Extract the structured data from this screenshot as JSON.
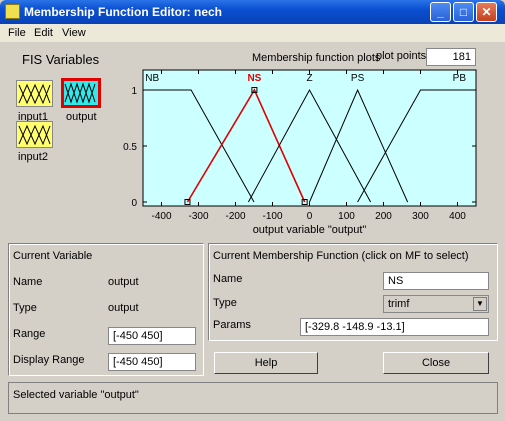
{
  "window": {
    "title": "Membership Function Editor: nech"
  },
  "menu": [
    "File",
    "Edit",
    "View"
  ],
  "fis_variables": {
    "title": "FIS Variables",
    "items": [
      {
        "label": "input1",
        "selected": false
      },
      {
        "label": "output",
        "selected": true
      },
      {
        "label": "input2",
        "selected": false
      }
    ]
  },
  "plot": {
    "header": "Membership function plots",
    "plot_points_label": "plot points:",
    "plot_points_value": "181",
    "xlabel": "output variable \"output\"",
    "xlim": [
      -450,
      450
    ],
    "ylim": [
      0,
      1
    ],
    "xticks": [
      -400,
      -300,
      -200,
      -100,
      0,
      100,
      200,
      300,
      400
    ],
    "yticks": [
      0,
      0.5,
      1
    ],
    "background": "#ccffff",
    "line_color": "#000000",
    "selected_color": "#e00000"
  },
  "chart_data": {
    "type": "line",
    "title": "",
    "xlabel": "output variable \"output\"",
    "ylabel": "",
    "xlim": [
      -450,
      450
    ],
    "ylim": [
      0,
      1
    ],
    "series": [
      {
        "name": "NB",
        "mf_type": "trapmf",
        "points": [
          [
            -450,
            1
          ],
          [
            -320,
            1
          ],
          [
            -150,
            0
          ]
        ],
        "selected": false
      },
      {
        "name": "NS",
        "mf_type": "trimf",
        "points": [
          [
            -329.8,
            0
          ],
          [
            -148.9,
            1
          ],
          [
            -13.1,
            0
          ]
        ],
        "selected": true
      },
      {
        "name": "Z",
        "mf_type": "trimf",
        "points": [
          [
            -165,
            0
          ],
          [
            0,
            1
          ],
          [
            165,
            0
          ]
        ],
        "selected": false
      },
      {
        "name": "PS",
        "mf_type": "trimf",
        "points": [
          [
            0,
            0
          ],
          [
            130,
            1
          ],
          [
            265,
            0
          ]
        ],
        "selected": false
      },
      {
        "name": "PB",
        "mf_type": "trapmf",
        "points": [
          [
            130,
            0
          ],
          [
            300,
            1
          ],
          [
            450,
            1
          ]
        ],
        "selected": false
      }
    ]
  },
  "current_variable": {
    "title": "Current Variable",
    "name_label": "Name",
    "name_value": "output",
    "type_label": "Type",
    "type_value": "output",
    "range_label": "Range",
    "range_value": "[-450 450]",
    "display_range_label": "Display Range",
    "display_range_value": "[-450 450]"
  },
  "current_mf": {
    "title": "Current Membership Function (click on MF to select)",
    "name_label": "Name",
    "name_value": "NS",
    "type_label": "Type",
    "type_value": "trimf",
    "params_label": "Params",
    "params_value": "[-329.8 -148.9 -13.1]"
  },
  "buttons": {
    "help": "Help",
    "close": "Close"
  },
  "status": "Selected variable \"output\""
}
